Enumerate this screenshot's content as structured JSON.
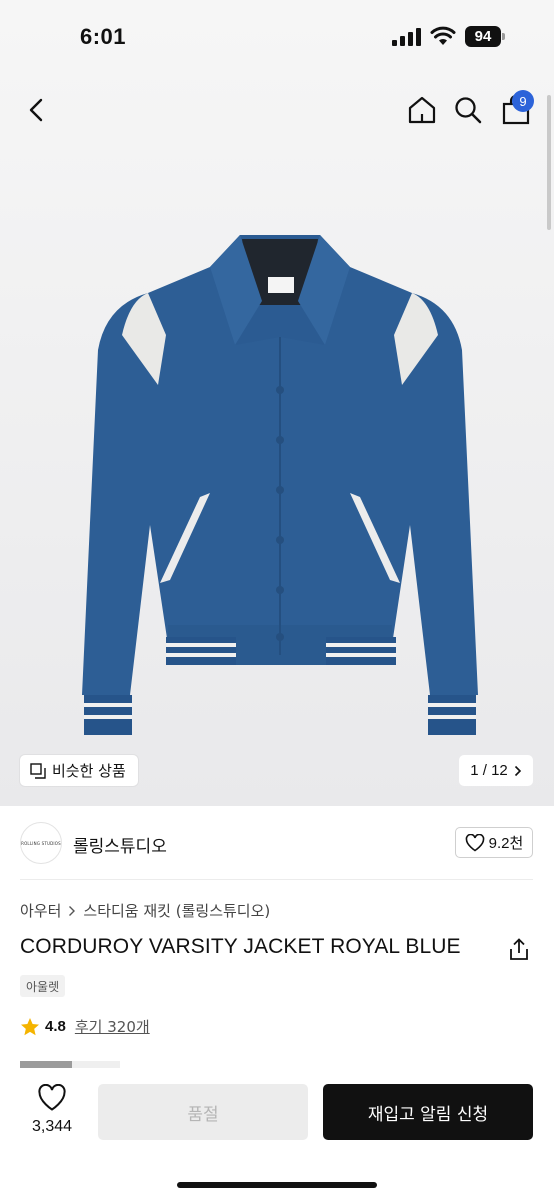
{
  "status_bar": {
    "time": "6:01",
    "battery": "94"
  },
  "nav": {
    "cart_count": "9"
  },
  "gallery": {
    "similar_label": "비슷한 상품",
    "page_indicator": "1 / 12"
  },
  "brand": {
    "name": "롤링스튜디오",
    "logo_text": "ROLLING STUDIOS",
    "likes": "9.2천"
  },
  "breadcrumb": {
    "category": "아우터",
    "subcategory": "스타디움 재킷 (롤링스튜디오)"
  },
  "product": {
    "title": "CORDUROY VARSITY JACKET ROYAL BLUE",
    "tag": "아울렛"
  },
  "rating": {
    "score": "4.8",
    "reviews_label": "후기 320개"
  },
  "bottom_bar": {
    "wish_count": "3,344",
    "soldout_label": "품절",
    "restock_label": "재입고 알림 신청"
  },
  "colors": {
    "accent_badge": "#2c63d9",
    "jacket": "#2d5e95",
    "star": "#f5b400",
    "primary_button": "#111111"
  }
}
